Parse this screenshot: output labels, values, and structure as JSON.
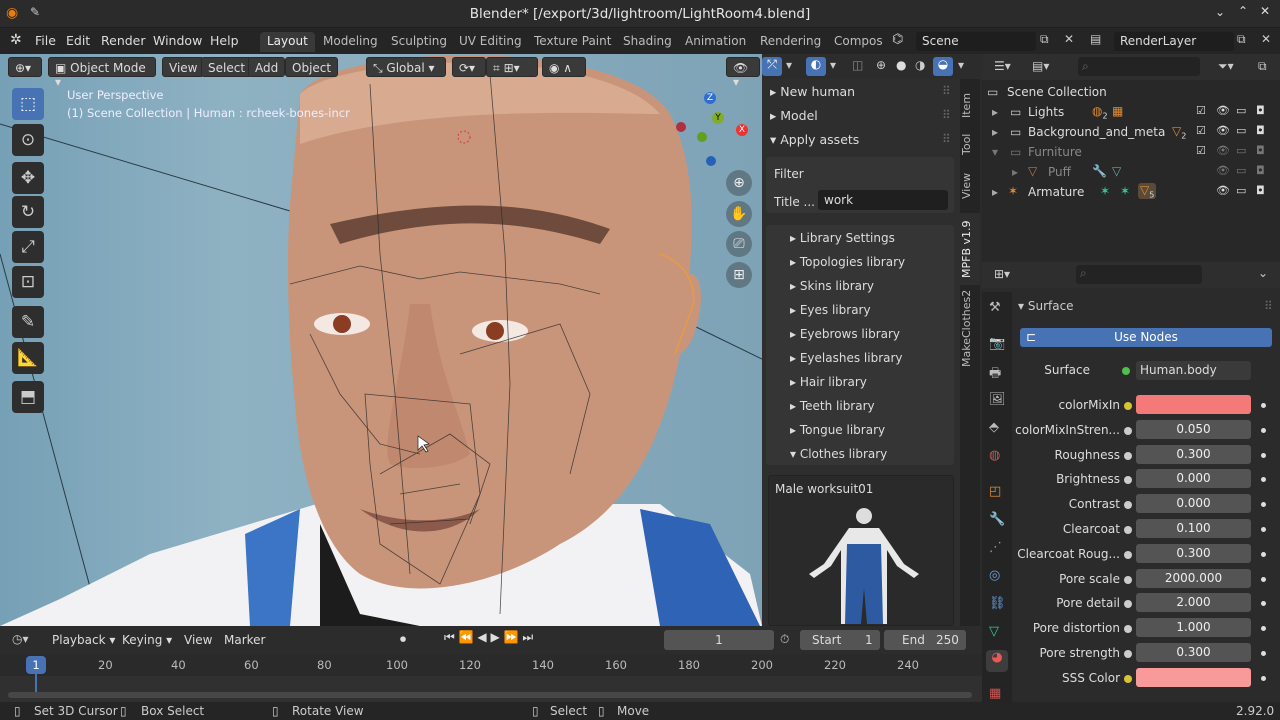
{
  "window": {
    "title": "Blender* [/export/3d/lightroom/LightRoom4.blend]",
    "version": "2.92.0"
  },
  "menus": [
    "File",
    "Edit",
    "Render",
    "Window",
    "Help"
  ],
  "workspaces": [
    "Layout",
    "Modeling",
    "Sculpting",
    "UV Editing",
    "Texture Paint",
    "Shading",
    "Animation",
    "Rendering",
    "Compos"
  ],
  "scene": {
    "name": "Scene",
    "render_layer": "RenderLayer"
  },
  "viewport": {
    "mode": "Object Mode",
    "menus": [
      "View",
      "Select",
      "Add",
      "Object"
    ],
    "orientation": "Global",
    "overlay_line1": "User Perspective",
    "overlay_line2": "(1) Scene Collection | Human : rcheek-bones-incr",
    "gizmo": {
      "z": "Z",
      "y": "Y",
      "x": "X"
    }
  },
  "npanel": {
    "sections": [
      "New human",
      "Model",
      "Apply assets"
    ],
    "filter_label": "Filter",
    "title_label": "Title ...",
    "title_value": "work",
    "libraries": [
      "Library Settings",
      "Topologies library",
      "Skins library",
      "Eyes library",
      "Eyebrows library",
      "Eyelashes library",
      "Hair library",
      "Teeth library",
      "Tongue library",
      "Clothes library"
    ],
    "asset_name": "Male worksuit01",
    "tabs": [
      "Item",
      "Tool",
      "View",
      "MPFB v1.9",
      "MakeClothes2"
    ]
  },
  "outliner": {
    "root": "Scene Collection",
    "items": [
      {
        "name": "Lights",
        "badge": "2"
      },
      {
        "name": "Background_and_meta",
        "badge": "2"
      },
      {
        "name": "Furniture",
        "badge": ""
      },
      {
        "name": "Puff",
        "badge": ""
      },
      {
        "name": "Armature",
        "badge": "5"
      }
    ]
  },
  "properties": {
    "panel": "Surface",
    "use_nodes": "Use Nodes",
    "surface_label": "Surface",
    "surface_value": "Human.body",
    "rows": [
      {
        "label": "colorMixIn",
        "value": "",
        "color": "#f47a7a"
      },
      {
        "label": "colorMixInStren...",
        "value": "0.050"
      },
      {
        "label": "Roughness",
        "value": "0.300"
      },
      {
        "label": "Brightness",
        "value": "0.000"
      },
      {
        "label": "Contrast",
        "value": "0.000"
      },
      {
        "label": "Clearcoat",
        "value": "0.100"
      },
      {
        "label": "Clearcoat Roug...",
        "value": "0.300"
      },
      {
        "label": "Pore scale",
        "value": "2000.000"
      },
      {
        "label": "Pore detail",
        "value": "2.000"
      },
      {
        "label": "Pore distortion",
        "value": "1.000"
      },
      {
        "label": "Pore strength",
        "value": "0.300"
      },
      {
        "label": "SSS Color",
        "value": "",
        "color": "#f99a9a"
      }
    ]
  },
  "timeline": {
    "menus": [
      "Playback",
      "Keying",
      "View",
      "Marker"
    ],
    "current_frame": "1",
    "start_label": "Start",
    "start": "1",
    "end_label": "End",
    "end": "250",
    "ruler": [
      "1",
      "20",
      "40",
      "60",
      "80",
      "100",
      "120",
      "140",
      "160",
      "180",
      "200",
      "220",
      "240"
    ]
  },
  "status": {
    "items": [
      "Set 3D Cursor",
      "Box Select",
      "Rotate View",
      "Select",
      "Move"
    ]
  }
}
